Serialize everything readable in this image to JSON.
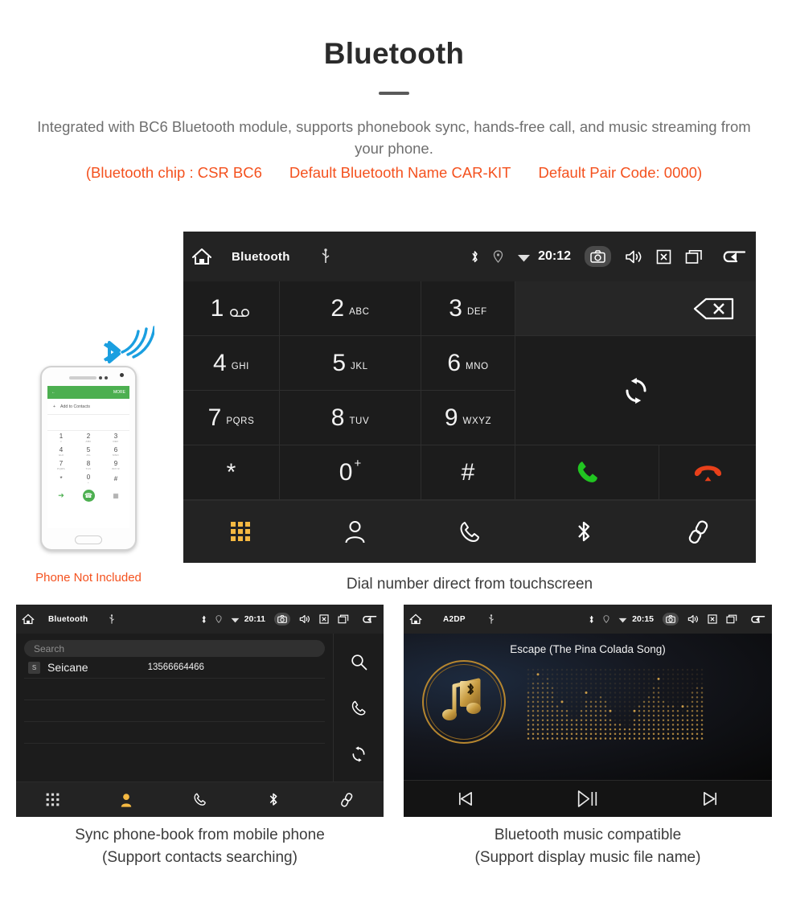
{
  "header": {
    "title": "Bluetooth",
    "subtitle": "Integrated with BC6 Bluetooth module, supports phonebook sync, hands-free call, and music streaming from your phone.",
    "spec_chip": "(Bluetooth chip : CSR BC6",
    "spec_name": "Default Bluetooth Name CAR-KIT",
    "spec_pair": "Default Pair Code: 0000)",
    "accent_color": "#f4511e",
    "subtitle_color": "#6f6f6f"
  },
  "dialer": {
    "statusbar": {
      "title": "Bluetooth",
      "time": "20:12",
      "icons": [
        "home-icon",
        "usb-icon",
        "bluetooth-icon",
        "location-icon",
        "wifi-icon",
        "camera-icon",
        "volume-icon",
        "close-box-icon",
        "recents-icon",
        "back-icon"
      ]
    },
    "keys": [
      {
        "digit": "1",
        "letters": "",
        "voicemail": true
      },
      {
        "digit": "2",
        "letters": "ABC"
      },
      {
        "digit": "3",
        "letters": "DEF"
      },
      {
        "digit": "4",
        "letters": "GHI"
      },
      {
        "digit": "5",
        "letters": "JKL"
      },
      {
        "digit": "6",
        "letters": "MNO"
      },
      {
        "digit": "7",
        "letters": "PQRS"
      },
      {
        "digit": "8",
        "letters": "TUV"
      },
      {
        "digit": "9",
        "letters": "WXYZ"
      },
      {
        "digit": "*",
        "letters": ""
      },
      {
        "digit": "0",
        "letters": "",
        "plus": "+"
      },
      {
        "digit": "#",
        "letters": ""
      }
    ],
    "actions": {
      "backspace": "backspace-icon",
      "sync": "sync-icon",
      "call": "call-icon",
      "hangup": "hangup-icon",
      "call_color": "#21c521",
      "hangup_color": "#e8401a"
    },
    "tabs": [
      {
        "name": "keypad",
        "active": true
      },
      {
        "name": "contacts",
        "active": false
      },
      {
        "name": "call-log",
        "active": false
      },
      {
        "name": "bluetooth",
        "active": false
      },
      {
        "name": "pair-link",
        "active": false
      }
    ],
    "active_tab_color": "#f5b942",
    "caption": "Dial number direct from touchscreen"
  },
  "phone_mock": {
    "header_more": "MORE",
    "add_to_contacts": "Add to Contacts",
    "keys": [
      {
        "digit": "1",
        "letters": "∞"
      },
      {
        "digit": "2",
        "letters": "ABC"
      },
      {
        "digit": "3",
        "letters": "DEF"
      },
      {
        "digit": "4",
        "letters": "GHI"
      },
      {
        "digit": "5",
        "letters": "JKL"
      },
      {
        "digit": "6",
        "letters": "MNO"
      },
      {
        "digit": "7",
        "letters": "PQRS"
      },
      {
        "digit": "8",
        "letters": "TUV"
      },
      {
        "digit": "9",
        "letters": "WXYZ"
      },
      {
        "digit": "*",
        "letters": ""
      },
      {
        "digit": "0",
        "letters": "+"
      },
      {
        "digit": "#",
        "letters": ""
      }
    ],
    "disclaimer": "Phone Not Included",
    "disclaimer_color": "#f4511e",
    "bluetooth_wave_color": "#1a9fe0"
  },
  "contacts": {
    "statusbar": {
      "title": "Bluetooth",
      "time": "20:11"
    },
    "search_placeholder": "Search",
    "rows": [
      {
        "badge": "S",
        "name": "Seicane",
        "number": "13566664466"
      }
    ],
    "side_icons": [
      "search-icon",
      "call-icon",
      "sync-icon"
    ],
    "tabs": [
      {
        "name": "keypad",
        "active": false
      },
      {
        "name": "contacts",
        "active": true
      },
      {
        "name": "call-log",
        "active": false
      },
      {
        "name": "bluetooth",
        "active": false
      },
      {
        "name": "pair-link",
        "active": false
      }
    ],
    "caption_line1": "Sync phone-book from mobile phone",
    "caption_line2": "(Support contacts searching)"
  },
  "music": {
    "statusbar": {
      "title": "A2DP",
      "time": "20:15"
    },
    "song_title": "Escape (The Pina Colada Song)",
    "controls": [
      "previous-icon",
      "play-pause-icon",
      "next-icon"
    ],
    "accent_gold": "#d3a24a",
    "caption_line1": "Bluetooth music compatible",
    "caption_line2": "(Support display music file name)"
  }
}
